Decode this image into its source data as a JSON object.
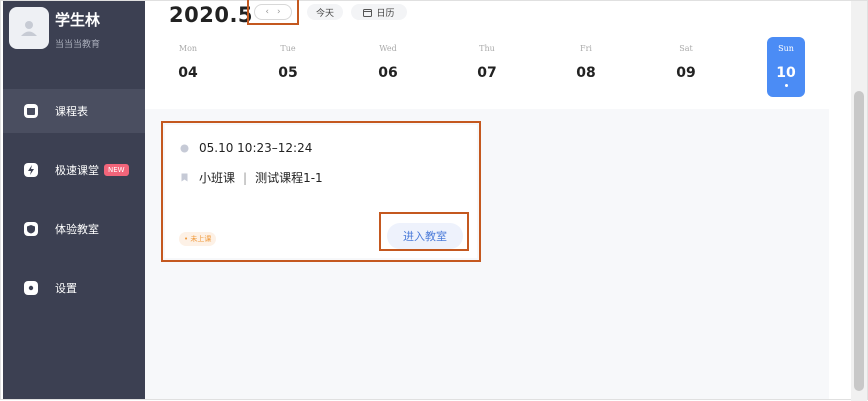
{
  "user": {
    "name": "学生林",
    "org": "当当当教育"
  },
  "sidebar": {
    "items": [
      {
        "label": "课程表",
        "icon": "calendar-icon",
        "active": true
      },
      {
        "label": "极速课堂",
        "icon": "lightning-icon",
        "badge": "NEW"
      },
      {
        "label": "体验教室",
        "icon": "shield-icon"
      },
      {
        "label": "设置",
        "icon": "gear-icon"
      }
    ]
  },
  "header": {
    "month": "2020.5",
    "prev": "‹",
    "next": "›",
    "today": "今天",
    "calendar": "日历"
  },
  "week": [
    {
      "name": "Mon",
      "num": "04"
    },
    {
      "name": "Tue",
      "num": "05"
    },
    {
      "name": "Wed",
      "num": "06"
    },
    {
      "name": "Thu",
      "num": "07"
    },
    {
      "name": "Fri",
      "num": "08"
    },
    {
      "name": "Sat",
      "num": "09"
    },
    {
      "name": "Sun",
      "num": "10",
      "selected": true
    }
  ],
  "lesson": {
    "time": "05.10  10:23–12:24",
    "type": "小班课",
    "separator": "|",
    "course": "测试课程1-1",
    "status": "• 未上课",
    "enter": "进入教室"
  },
  "colors": {
    "sidebar": "#3c4052",
    "accent": "#4b8cf5",
    "highlight": "#c4581f",
    "status": "#f09a3c",
    "badge": "#f2657a"
  }
}
